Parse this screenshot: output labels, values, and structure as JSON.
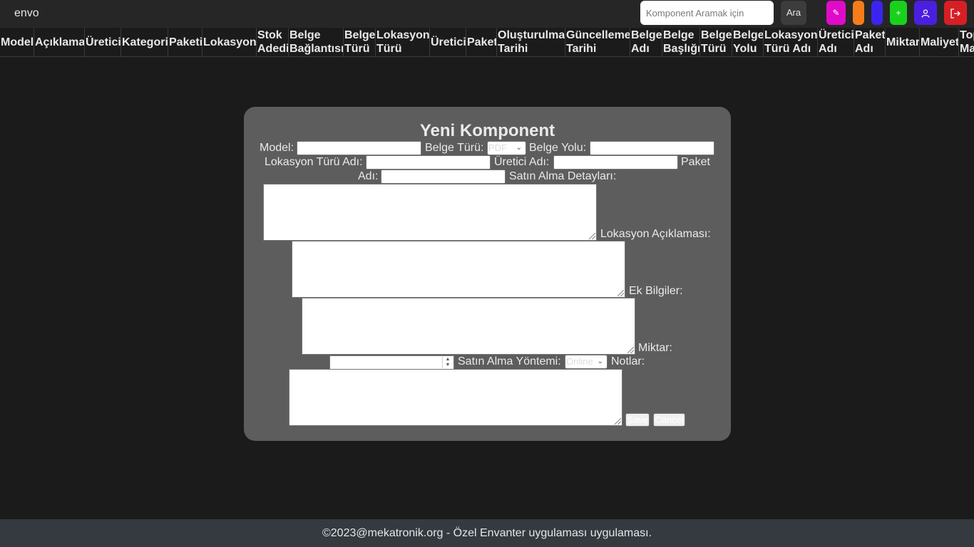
{
  "app": {
    "brand": "envo"
  },
  "search": {
    "placeholder": "Komponent Aramak için",
    "button_label": "Ara"
  },
  "toolbar": {
    "buttons": [
      {
        "icon": "pencil-icon",
        "glyph": "✎",
        "color": "#e00bc9"
      },
      {
        "icon": "blank",
        "glyph": "",
        "color": "#f57c1a"
      },
      {
        "icon": "blank",
        "glyph": "",
        "color": "#3b24f0"
      },
      {
        "icon": "plus-icon",
        "glyph": "+",
        "color": "#19d11d"
      },
      {
        "icon": "user-icon",
        "glyph": "",
        "color": "#4a1fe0"
      },
      {
        "icon": "logout-icon",
        "glyph": "",
        "color": "#d61f25"
      }
    ]
  },
  "table": {
    "headers": [
      "Model",
      "Açıklama",
      "Üretici",
      "Kategori",
      "Paketi",
      "Lokasyon",
      "Stok\nAdedi",
      "Belge\nBağlantısı",
      "Belge\nTürü",
      "Lokasyon\nTürü",
      "Üretici",
      "Paket",
      "Oluşturulma\nTarihi",
      "Güncelleme\nTarihi",
      "Belge\nAdı",
      "Belge\nBaşlığı",
      "Belge\nTürü",
      "Belge\nYolu",
      "Lokasyon\nTürü Adı",
      "Üretici\nAdı",
      "Paket\nAdı",
      "Miktar",
      "Maliyet",
      "Toplam\nMaliyet"
    ]
  },
  "modal": {
    "title": "Yeni Komponent",
    "labels": {
      "model": "Model:",
      "belge_turu": "Belge Türü:",
      "belge_yolu": "Belge Yolu:",
      "lokasyon_turu_adi": "Lokasyon Türü Adı:",
      "uretici_adi": "Üretici Adı:",
      "paket_adi_1": "Paket",
      "paket_adi_2": "Adı:",
      "satin_alma_detaylari": "Satın Alma Detayları:",
      "lokasyon_aciklamasi": "Lokasyon Açıklaması:",
      "ek_bilgiler": "Ek Bilgiler:",
      "miktar": "Miktar:",
      "satin_alma_yontemi": "Satın Alma Yöntemi:",
      "notlar": "Notlar:"
    },
    "belge_turu_value": "PDF",
    "satin_alma_yontemi_value": "Online",
    "save_label": "Save",
    "cancel_label": "Cancel"
  },
  "footer": {
    "text": "©2023@mekatronik.org - Özel Envanter uygulaması uygulaması."
  }
}
